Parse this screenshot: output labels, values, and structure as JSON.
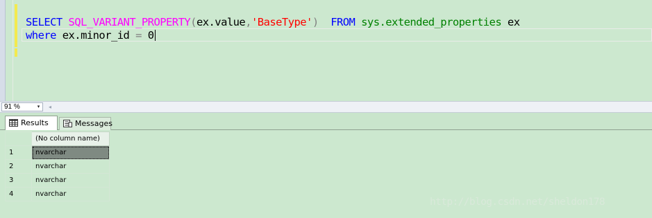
{
  "editor": {
    "line1": {
      "select": "SELECT",
      "function": "SQL_VARIANT_PROPERTY",
      "open_paren": "(",
      "arg": "ex.value",
      "comma": ",",
      "string": "'BaseType'",
      "close_paren": ")",
      "from": "FROM",
      "table": "sys.extended_properties",
      "alias": "ex"
    },
    "line2": {
      "where": "where",
      "column": "ex.minor_id",
      "operator": "=",
      "value": "0"
    }
  },
  "zoom": {
    "value": "91 %",
    "dropdown_glyph": "▾",
    "scroll_left_glyph": "◂"
  },
  "tabs": [
    {
      "label": "Results",
      "icon": "grid-icon",
      "active": true
    },
    {
      "label": "Messages",
      "icon": "messages-icon",
      "active": false
    }
  ],
  "grid": {
    "column_header": "(No column name)",
    "rows": [
      {
        "num": "1",
        "value": "nvarchar"
      },
      {
        "num": "2",
        "value": "nvarchar"
      },
      {
        "num": "3",
        "value": "nvarchar"
      },
      {
        "num": "4",
        "value": "nvarchar"
      }
    ]
  },
  "watermark": "http://blog.csdn.net/sheldon178",
  "colors": {
    "background": "#cce8cf",
    "keyword": "#0000ff",
    "function": "#ff00ff",
    "string": "#ff0000",
    "system_object": "#008000",
    "operator": "#808080",
    "change_bar": "#f3ea4e"
  }
}
